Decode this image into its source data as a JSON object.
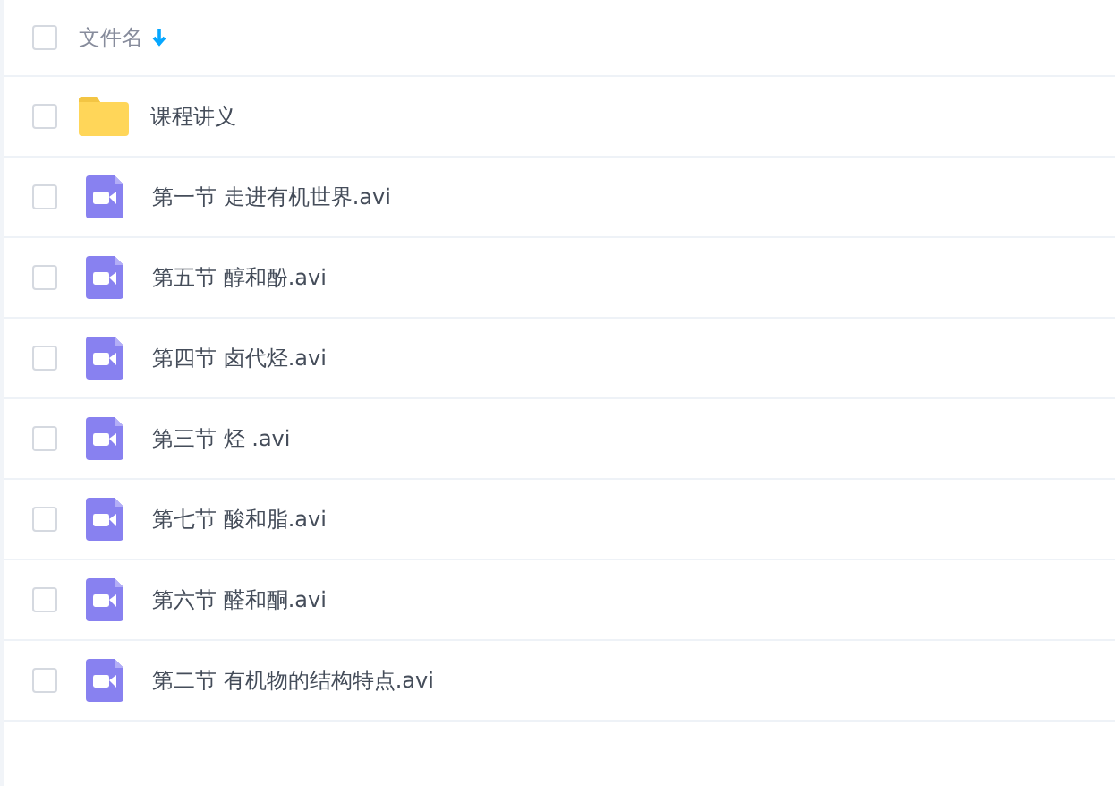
{
  "header": {
    "label": "文件名",
    "checked": false
  },
  "files": [
    {
      "kind": "folder",
      "name": "课程讲义",
      "checked": false
    },
    {
      "kind": "video",
      "name": "第一节 走进有机世界.avi",
      "checked": false
    },
    {
      "kind": "video",
      "name": "第五节 醇和酚.avi",
      "checked": false
    },
    {
      "kind": "video",
      "name": "第四节 卤代烃.avi",
      "checked": false
    },
    {
      "kind": "video",
      "name": "第三节 烃 .avi",
      "checked": false
    },
    {
      "kind": "video",
      "name": "第七节 酸和脂.avi",
      "checked": false
    },
    {
      "kind": "video",
      "name": "第六节 醛和酮.avi",
      "checked": false
    },
    {
      "kind": "video",
      "name": "第二节 有机物的结构特点.avi",
      "checked": false
    }
  ]
}
